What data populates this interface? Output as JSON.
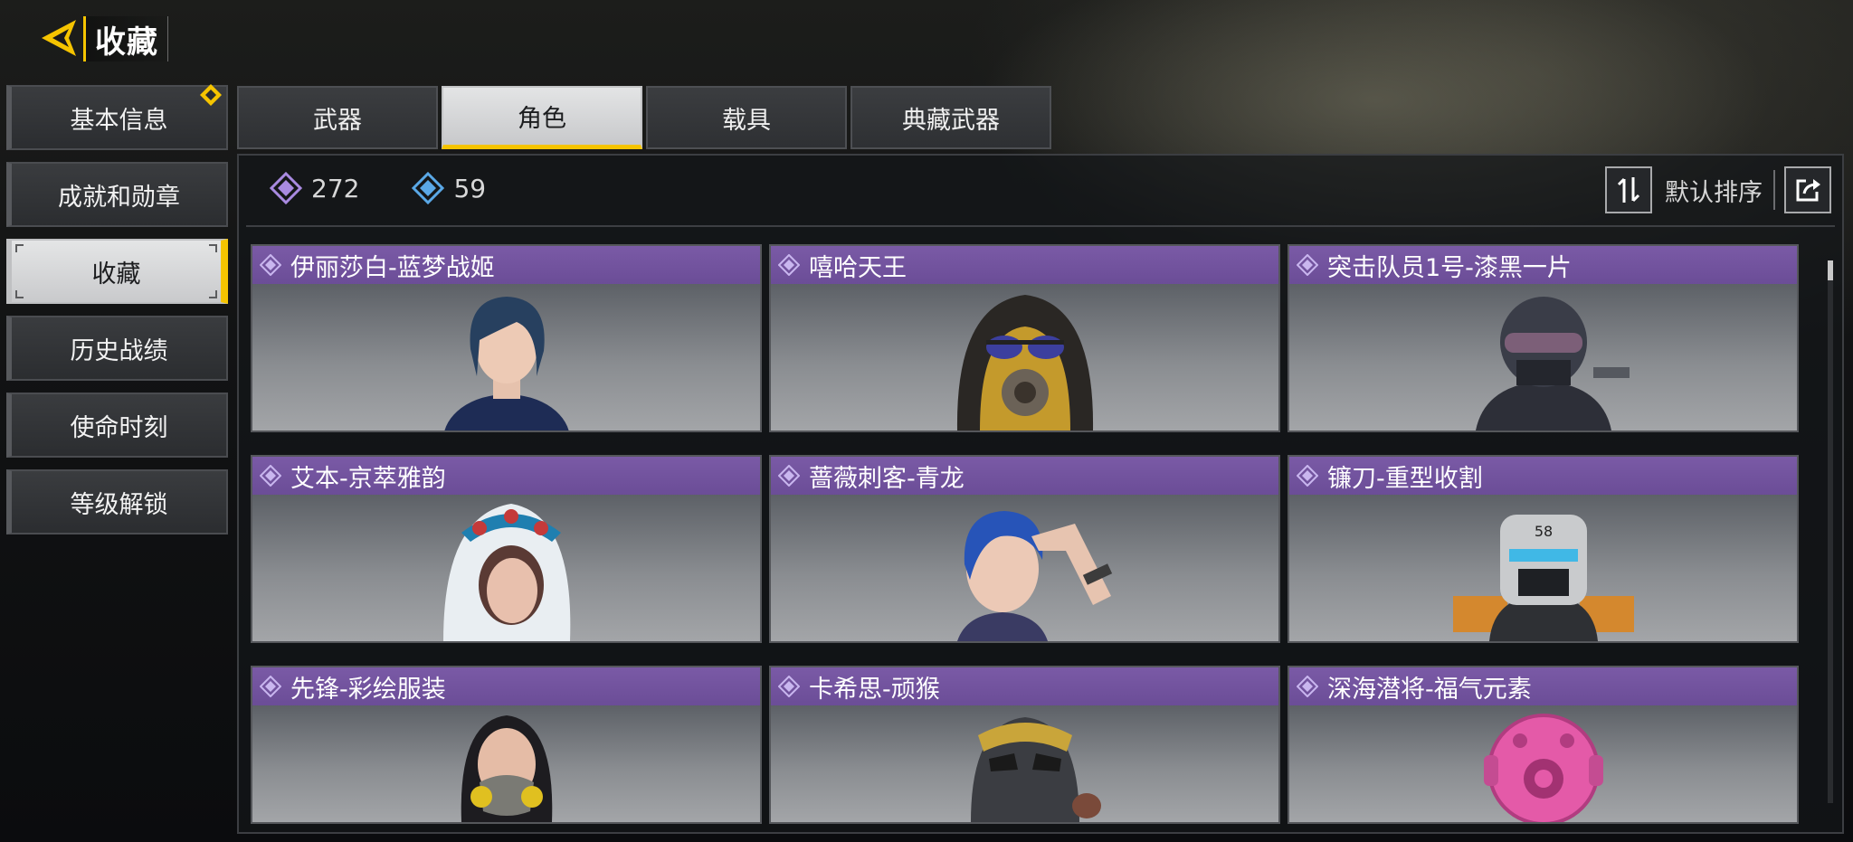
{
  "header": {
    "back_icon": "back-arrow-icon",
    "title": "收藏"
  },
  "sidebar": {
    "items": [
      {
        "label": "基本信息",
        "badge": true
      },
      {
        "label": "成就和勋章"
      },
      {
        "label": "收藏",
        "active": true
      },
      {
        "label": "历史战绩"
      },
      {
        "label": "使命时刻"
      },
      {
        "label": "等级解锁"
      }
    ]
  },
  "tabs": [
    {
      "label": "武器"
    },
    {
      "label": "角色",
      "active": true
    },
    {
      "label": "载具"
    },
    {
      "label": "典藏武器"
    }
  ],
  "stats": {
    "purple_count": "272",
    "blue_count": "59"
  },
  "toolbar": {
    "sort_label": "默认排序",
    "sort_icon": "sort-arrows-icon",
    "share_icon": "share-icon"
  },
  "cards": [
    {
      "name": "伊丽莎白-蓝梦战姬"
    },
    {
      "name": "嘻哈天王"
    },
    {
      "name": "突击队员1号-漆黑一片"
    },
    {
      "name": "艾本-京萃雅韵"
    },
    {
      "name": "蔷薇刺客-青龙"
    },
    {
      "name": "镰刀-重型收割"
    },
    {
      "name": "先锋-彩绘服装"
    },
    {
      "name": "卡希思-顽猴"
    },
    {
      "name": "深海潜将-福气元素"
    }
  ],
  "colors": {
    "accent": "#f5c400",
    "card_header": "#6b4d97",
    "rarity_purple": "#a98ae0",
    "rarity_blue": "#5aa8e6"
  }
}
